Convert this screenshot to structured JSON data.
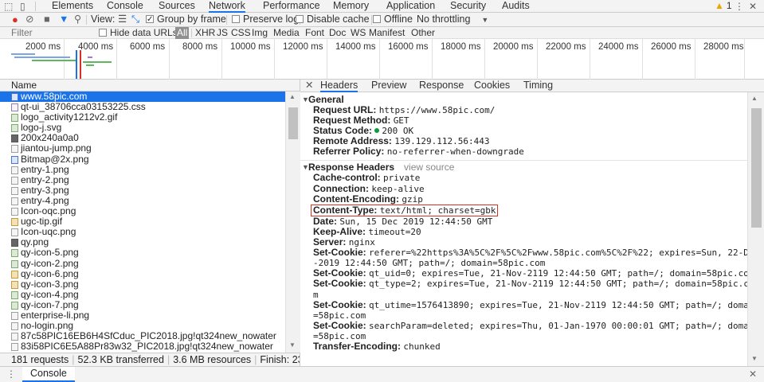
{
  "tabs": {
    "items": [
      "Elements",
      "Console",
      "Sources",
      "Network",
      "Performance",
      "Memory",
      "Application",
      "Security",
      "Audits"
    ],
    "active": "Network",
    "warning_count": "1"
  },
  "toolbar": {
    "view_label": "View:",
    "group_by_frame": "Group by frame",
    "preserve_log": "Preserve log",
    "disable_cache": "Disable cache",
    "offline": "Offline",
    "throttling": "No throttling"
  },
  "filter": {
    "placeholder": "Filter",
    "hide_data_urls": "Hide data URLs",
    "types": [
      "All",
      "XHR",
      "JS",
      "CSS",
      "Img",
      "Media",
      "Font",
      "Doc",
      "WS",
      "Manifest",
      "Other"
    ]
  },
  "overview": {
    "ticks": [
      "2000 ms",
      "4000 ms",
      "6000 ms",
      "8000 ms",
      "10000 ms",
      "12000 ms",
      "14000 ms",
      "16000 ms",
      "18000 ms",
      "20000 ms",
      "22000 ms",
      "24000 ms",
      "26000 ms",
      "28000 ms"
    ]
  },
  "requests": {
    "header": "Name",
    "items": [
      {
        "name": "www.58pic.com",
        "type": "doc",
        "selected": true
      },
      {
        "name": "qt-ui_38706cca03153225.css",
        "type": "css"
      },
      {
        "name": "logo_activity1212v2.gif",
        "type": "img"
      },
      {
        "name": "logo-j.svg",
        "type": "img"
      },
      {
        "name": "200x240a0a0",
        "type": "dark"
      },
      {
        "name": "jiantou-jump.png",
        "type": "plain"
      },
      {
        "name": "Bitmap@2x.png",
        "type": "doc"
      },
      {
        "name": "entry-1.png",
        "type": "plain"
      },
      {
        "name": "entry-2.png",
        "type": "plain"
      },
      {
        "name": "entry-3.png",
        "type": "plain"
      },
      {
        "name": "entry-4.png",
        "type": "plain"
      },
      {
        "name": "Icon-oqc.png",
        "type": "plain"
      },
      {
        "name": "ugc-tip.gif",
        "type": "img2"
      },
      {
        "name": "Icon-uqc.png",
        "type": "plain"
      },
      {
        "name": "qy.png",
        "type": "dark"
      },
      {
        "name": "qy-icon-5.png",
        "type": "img"
      },
      {
        "name": "qy-icon-2.png",
        "type": "img"
      },
      {
        "name": "qy-icon-6.png",
        "type": "img2"
      },
      {
        "name": "qy-icon-3.png",
        "type": "img2"
      },
      {
        "name": "qy-icon-4.png",
        "type": "img"
      },
      {
        "name": "qy-icon-7.png",
        "type": "img"
      },
      {
        "name": "enterprise-li.png",
        "type": "plain"
      },
      {
        "name": "no-login.png",
        "type": "plain"
      },
      {
        "name": "87c58PIC16EB6H4SfCduc_PIC2018.jpg!qt324new_nowater",
        "type": "plain"
      },
      {
        "name": "83i58PIC6E5A88Pr83w32_PIC2018.jpg!qt324new_nowater",
        "type": "plain"
      }
    ]
  },
  "status": {
    "requests": "181 requests",
    "transferred": "52.3 KB transferred",
    "resources": "3.6 MB resources",
    "finish": "Finish: 23..."
  },
  "detail": {
    "tabs": [
      "Headers",
      "Preview",
      "Response",
      "Cookies",
      "Timing"
    ],
    "active": "Headers",
    "general_title": "General",
    "general": [
      {
        "k": "Request URL:",
        "v": "https://www.58pic.com/"
      },
      {
        "k": "Request Method:",
        "v": "GET"
      },
      {
        "k": "Status Code:",
        "v": "200 OK"
      },
      {
        "k": "Remote Address:",
        "v": "139.129.112.56:443"
      },
      {
        "k": "Referrer Policy:",
        "v": "no-referrer-when-downgrade"
      }
    ],
    "response_title": "Response Headers",
    "view_source": "view source",
    "response": [
      {
        "k": "Cache-control:",
        "v": "private"
      },
      {
        "k": "Connection:",
        "v": "keep-alive"
      },
      {
        "k": "Content-Encoding:",
        "v": "gzip"
      },
      {
        "k": "Content-Type:",
        "v": "text/html; charset=gbk"
      },
      {
        "k": "Date:",
        "v": "Sun, 15 Dec 2019 12:44:50 GMT"
      },
      {
        "k": "Keep-Alive:",
        "v": "timeout=20"
      },
      {
        "k": "Server:",
        "v": "nginx"
      },
      {
        "k": "Set-Cookie:",
        "v": "referer=%22https%3A%5C%2F%5C%2Fwww.58pic.com%5C%2F%22; expires=Sun, 22-D",
        "v2": "-2019 12:44:50 GMT; path=/; domain=58pic.com"
      },
      {
        "k": "Set-Cookie:",
        "v": "qt_uid=0; expires=Tue, 21-Nov-2119 12:44:50 GMT; path=/; domain=58pic.co"
      },
      {
        "k": "Set-Cookie:",
        "v": "qt_type=2; expires=Tue, 21-Nov-2119 12:44:50 GMT; path=/; domain=58pic.co",
        "v2": "m"
      },
      {
        "k": "Set-Cookie:",
        "v": "qt_utime=1576413890; expires=Tue, 21-Nov-2119 12:44:50 GMT; path=/; doma",
        "v2": "=58pic.com"
      },
      {
        "k": "Set-Cookie:",
        "v": "searchParam=deleted; expires=Thu, 01-Jan-1970 00:00:01 GMT; path=/; doma",
        "v2": "=58pic.com"
      },
      {
        "k": "Transfer-Encoding:",
        "v": "chunked"
      }
    ]
  },
  "drawer": {
    "console_tab": "Console"
  }
}
